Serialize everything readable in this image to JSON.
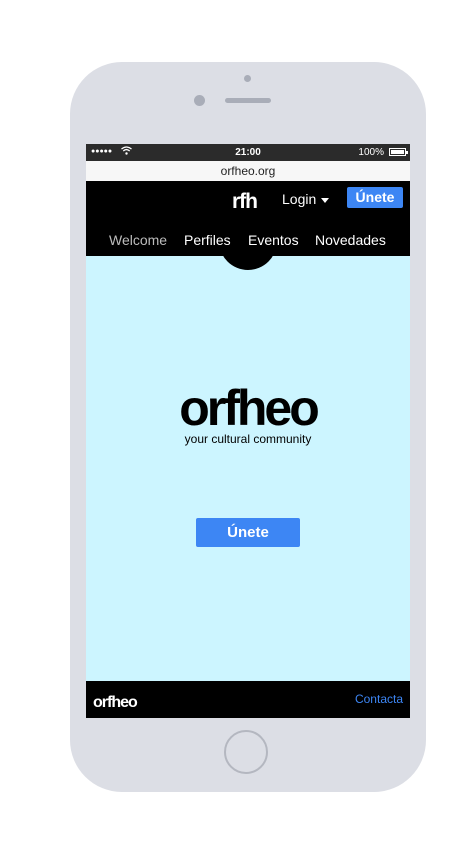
{
  "statusbar": {
    "signal": "●●●●●",
    "wifi_icon": "wifi-icon",
    "time": "21:00",
    "battery_pct": "100%"
  },
  "browser": {
    "url": "orfheo.org"
  },
  "header": {
    "logo": "rfh",
    "login_label": "Login",
    "join_label": "Únete",
    "nav": [
      "Welcome",
      "Perfiles",
      "Eventos",
      "Novedades"
    ]
  },
  "hero": {
    "logo": "orfheo",
    "tagline": "your cultural community",
    "join_label": "Únete"
  },
  "footer": {
    "logo": "orfheo",
    "contact_label": "Contacta"
  },
  "colors": {
    "accent": "#3d86f4",
    "background": "#ccf5ff",
    "header": "#000000",
    "phone_frame": "#dcdee5"
  }
}
